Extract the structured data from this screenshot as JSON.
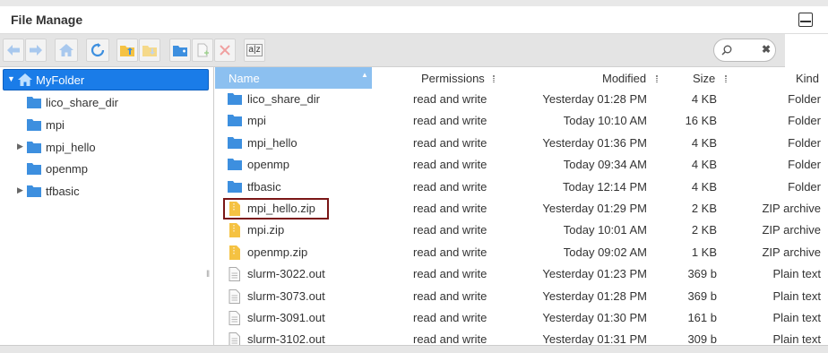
{
  "window": {
    "title": "File Manage"
  },
  "toolbar": {
    "buttons": [
      {
        "name": "back-button",
        "icon": "arrow-left-icon"
      },
      {
        "name": "forward-button",
        "icon": "arrow-right-icon"
      },
      {
        "name": "home-button",
        "icon": "home-icon"
      },
      {
        "name": "refresh-button",
        "icon": "refresh-icon"
      },
      {
        "name": "upload-button",
        "icon": "folder-upload-icon"
      },
      {
        "name": "download-button",
        "icon": "folder-download-icon"
      },
      {
        "name": "new-folder-button",
        "icon": "new-folder-icon"
      },
      {
        "name": "new-file-button",
        "icon": "new-file-icon"
      },
      {
        "name": "delete-button",
        "icon": "delete-icon"
      },
      {
        "name": "sort-button",
        "icon": "sort-az-icon"
      }
    ],
    "sort_label": "a|z",
    "search": {
      "placeholder": "",
      "clear": "✖"
    }
  },
  "tree": {
    "root": "MyFolder",
    "items": [
      "lico_share_dir",
      "mpi",
      "mpi_hello",
      "openmp",
      "tfbasic"
    ]
  },
  "columns": {
    "name": "Name",
    "permissions": "Permissions",
    "modified": "Modified",
    "size": "Size",
    "kind": "Kind"
  },
  "files": [
    {
      "name": "lico_share_dir",
      "perm": "read and write",
      "modified": "Yesterday 01:28 PM",
      "size": "4 KB",
      "kind": "Folder",
      "icon": "folder-icon"
    },
    {
      "name": "mpi",
      "perm": "read and write",
      "modified": "Today 10:10 AM",
      "size": "16 KB",
      "kind": "Folder",
      "icon": "folder-icon"
    },
    {
      "name": "mpi_hello",
      "perm": "read and write",
      "modified": "Yesterday 01:36 PM",
      "size": "4 KB",
      "kind": "Folder",
      "icon": "folder-icon"
    },
    {
      "name": "openmp",
      "perm": "read and write",
      "modified": "Today 09:34 AM",
      "size": "4 KB",
      "kind": "Folder",
      "icon": "folder-icon"
    },
    {
      "name": "tfbasic",
      "perm": "read and write",
      "modified": "Today 12:14 PM",
      "size": "4 KB",
      "kind": "Folder",
      "icon": "folder-icon"
    },
    {
      "name": "mpi_hello.zip",
      "perm": "read and write",
      "modified": "Yesterday 01:29 PM",
      "size": "2 KB",
      "kind": "ZIP archive",
      "icon": "zip-icon"
    },
    {
      "name": "mpi.zip",
      "perm": "read and write",
      "modified": "Today 10:01 AM",
      "size": "2 KB",
      "kind": "ZIP archive",
      "icon": "zip-icon"
    },
    {
      "name": "openmp.zip",
      "perm": "read and write",
      "modified": "Today 09:02 AM",
      "size": "1 KB",
      "kind": "ZIP archive",
      "icon": "zip-icon"
    },
    {
      "name": "slurm-3022.out",
      "perm": "read and write",
      "modified": "Yesterday 01:23 PM",
      "size": "369 b",
      "kind": "Plain text",
      "icon": "text-file-icon"
    },
    {
      "name": "slurm-3073.out",
      "perm": "read and write",
      "modified": "Yesterday 01:28 PM",
      "size": "369 b",
      "kind": "Plain text",
      "icon": "text-file-icon"
    },
    {
      "name": "slurm-3091.out",
      "perm": "read and write",
      "modified": "Yesterday 01:30 PM",
      "size": "161 b",
      "kind": "Plain text",
      "icon": "text-file-icon"
    },
    {
      "name": "slurm-3102.out",
      "perm": "read and write",
      "modified": "Yesterday 01:31 PM",
      "size": "309 b",
      "kind": "Plain text",
      "icon": "text-file-icon"
    }
  ],
  "colors": {
    "accent": "#1a7ce8",
    "folder": "#3d8fdf",
    "zip": "#f5c242",
    "focus": "#7a1616",
    "header_sel": "#8cc0f0"
  }
}
